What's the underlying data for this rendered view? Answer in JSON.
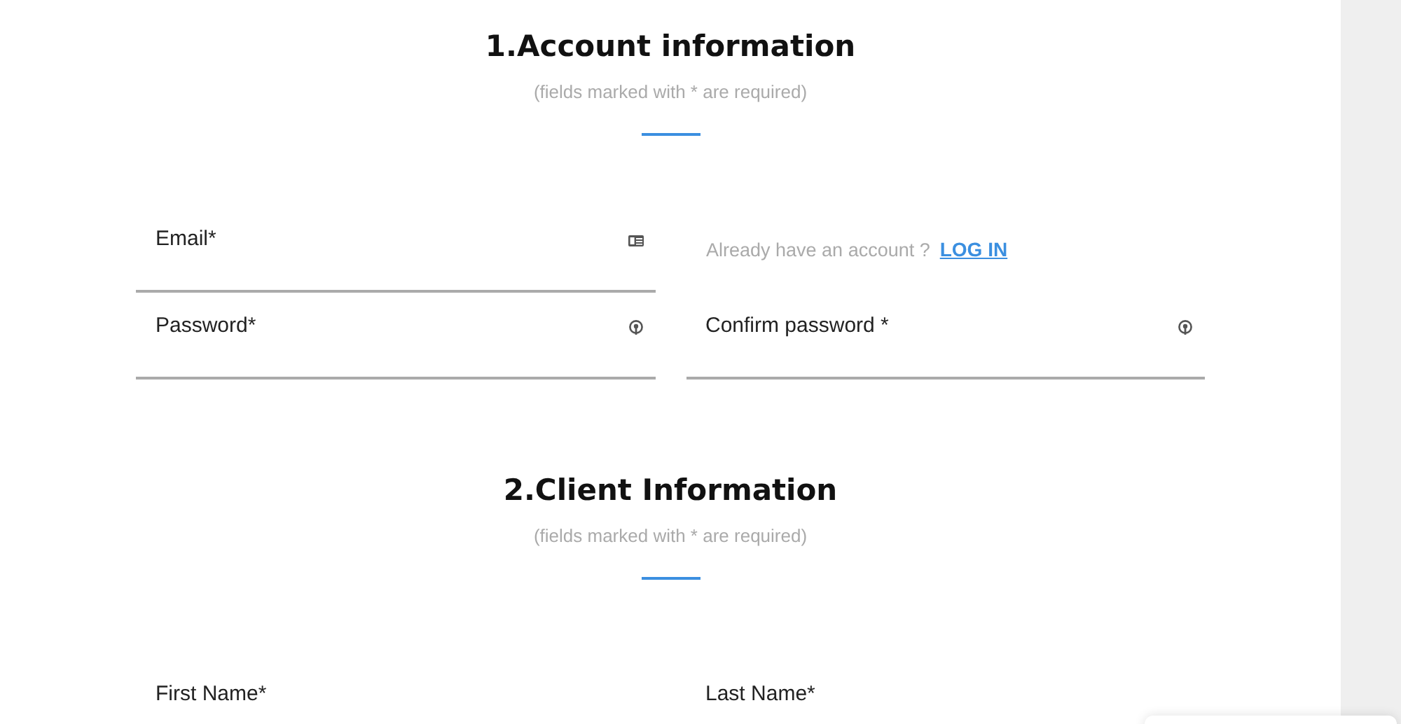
{
  "sections": [
    {
      "title": "1.Account information",
      "note": "(fields marked with * are required)",
      "rows": [
        [
          {
            "kind": "email",
            "placeholder": "Email*"
          },
          {
            "kind": "login",
            "text": "Already have an account ?",
            "link": "LOG IN"
          }
        ],
        [
          {
            "kind": "password",
            "placeholder": "Password*"
          },
          {
            "kind": "password",
            "placeholder": "Confirm password *"
          }
        ]
      ]
    },
    {
      "title": "2.Client Information",
      "note": "(fields marked with * are required)",
      "rows": [
        [
          {
            "kind": "text",
            "placeholder": "First Name*"
          },
          {
            "kind": "text",
            "placeholder": "Last Name*"
          }
        ]
      ]
    }
  ]
}
